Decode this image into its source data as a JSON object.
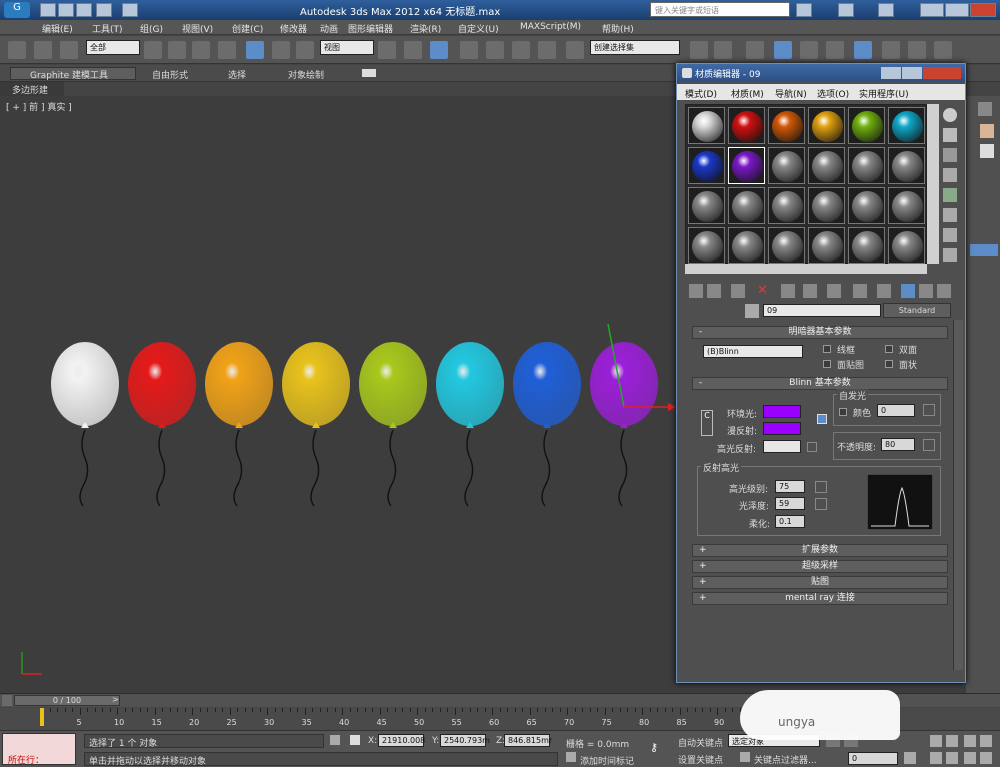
{
  "app": {
    "title": "Autodesk 3ds Max  2012 x64     无标题.max",
    "search_placeholder": "键入关键字或短语"
  },
  "menu": [
    "编辑(E)",
    "工具(T)",
    "组(G)",
    "视图(V)",
    "创建(C)",
    "修改器",
    "动画",
    "图形编辑器",
    "渲染(R)",
    "自定义(U)",
    "MAXScript(M)",
    "帮助(H)"
  ],
  "toolbar": {
    "selection_filter": "全部",
    "coord_system": "视图",
    "named_selection": "创建选择集"
  },
  "ribbon": {
    "tabs": [
      "Graphite 建模工具",
      "自由形式",
      "选择",
      "对象绘制"
    ],
    "sub": "多边形建模"
  },
  "viewport": {
    "label": "[ + ] 前 ] 真实 ]",
    "balloon_colors": [
      "#f2f2f2",
      "#e51a1a",
      "#f0a218",
      "#e8c21c",
      "#a8c81c",
      "#22c8e0",
      "#1f5fd8",
      "#9b1fd8"
    ]
  },
  "timeline": {
    "frame": "0 / 100",
    "ticks": [
      "5",
      "10",
      "15",
      "20",
      "25",
      "30",
      "35",
      "40",
      "45",
      "50",
      "55",
      "60",
      "65",
      "70",
      "75",
      "80",
      "85",
      "90"
    ]
  },
  "status": {
    "script_label": "所在行：",
    "message1": "选择了 1 个 对象",
    "message2": "单击并拖动以选择并移动对象",
    "x_label": "X:",
    "x": "21910.008",
    "y_label": "Y:",
    "y": "2540.793m",
    "z_label": "Z:",
    "z": "846.815mr",
    "grid": "栅格 = 0.0mm",
    "add_time_tag": "添加时间标记",
    "auto_key": "自动关键点",
    "set_key": "设置关键点",
    "selected": "选定对象",
    "key_filter": "关键点过滤器...",
    "frame": "0",
    "watermark": "ungya"
  },
  "material_editor": {
    "title": "材质编辑器 - 09",
    "menu": [
      "模式(D)",
      "材质(M)",
      "导航(N)",
      "选项(O)",
      "实用程序(U)"
    ],
    "slot_colors": [
      "#d8d8d8",
      "#d01010",
      "#d05808",
      "#e0a010",
      "#70b010",
      "#10a8c8",
      "#1a38c8",
      "#7a18c8",
      "#888888",
      "#888888",
      "#888888",
      "#888888",
      "#888888",
      "#888888",
      "#888888",
      "#888888",
      "#888888",
      "#888888",
      "#888888",
      "#888888",
      "#888888",
      "#888888",
      "#888888",
      "#888888"
    ],
    "material_name": "09",
    "material_type": "Standard",
    "shader_rollout": "明暗器基本参数",
    "shader": "(B)Blinn",
    "wire": "线框",
    "two_sided": "双面",
    "face_map": "面贴图",
    "faceted": "面状",
    "blinn_rollout": "Blinn 基本参数",
    "self_illum": "自发光",
    "color_label": "颜色",
    "self_illum_value": "0",
    "ambient": "环境光:",
    "diffuse": "漫反射:",
    "specular": "高光反射:",
    "diffuse_color": "#9a00ff",
    "specular_color": "#e6e6e6",
    "opacity_label": "不透明度:",
    "opacity": "80",
    "highlights": "反射高光",
    "spec_level_label": "高光级别:",
    "spec_level": "75",
    "gloss_label": "光泽度:",
    "gloss": "59",
    "soften_label": "柔化:",
    "soften": "0.1",
    "rollouts": [
      "扩展参数",
      "超级采样",
      "贴图",
      "mental ray 连接"
    ],
    "lock": "C"
  }
}
